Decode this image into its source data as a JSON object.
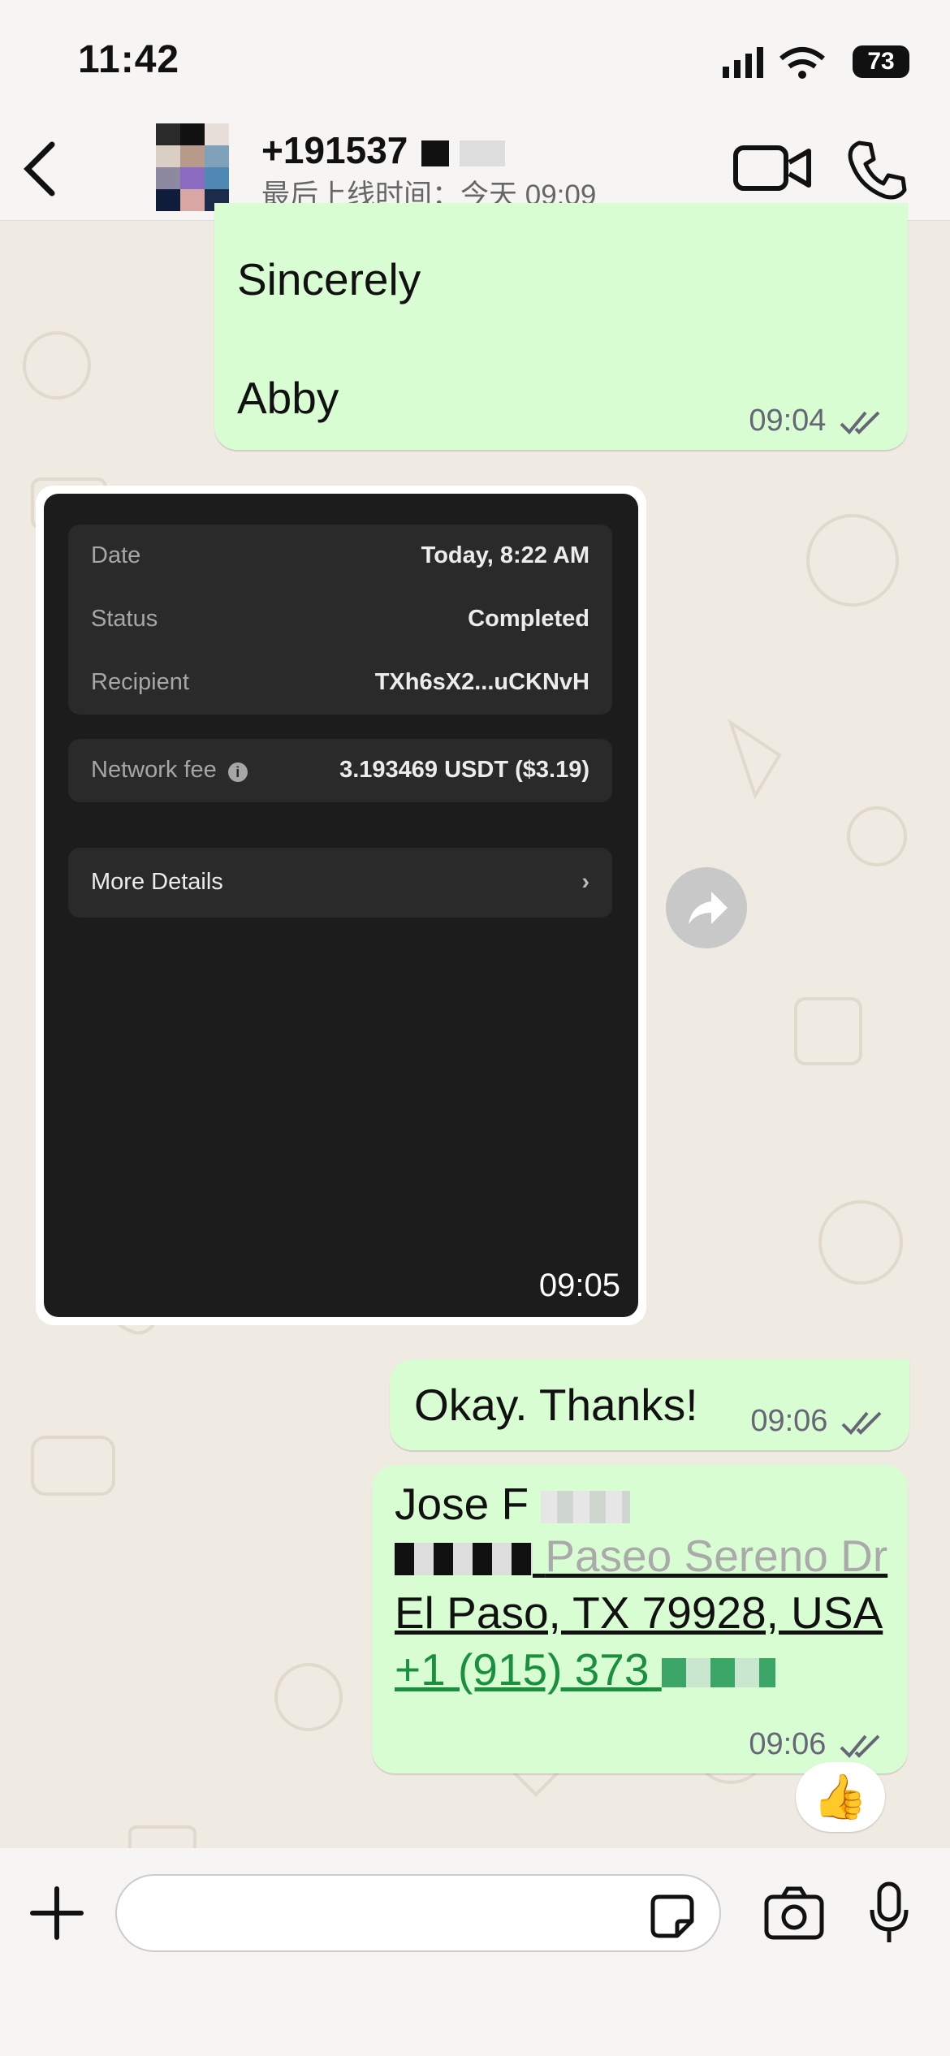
{
  "status_bar": {
    "time": "11:42",
    "battery": "73"
  },
  "header": {
    "contact": "+191537",
    "last_seen": "最后上线时间：今天 09:09"
  },
  "messages": {
    "m1": {
      "line1": "Sincerely",
      "line2": "Abby",
      "time": "09:04"
    },
    "m2": {
      "time": "09:05",
      "details": {
        "date_label": "Date",
        "date_value": "Today, 8:22 AM",
        "status_label": "Status",
        "status_value": "Completed",
        "recipient_label": "Recipient",
        "recipient_value": "TXh6sX2...uCKNvH",
        "fee_label": "Network fee",
        "fee_value": "3.193469 USDT ($3.19)",
        "more_label": "More Details"
      }
    },
    "m3": {
      "text": "Okay. Thanks!",
      "time": "09:06"
    },
    "m4": {
      "line1": "Jose F",
      "line2": "Paseo Sereno Dr",
      "line3": "El Paso, TX 79928, USA",
      "line4": "+1 (915) 373",
      "time": "09:06"
    },
    "reaction": "👍"
  },
  "colors": {
    "bubble_out": "#d9fdd3",
    "chat_bg": "#efeae2",
    "link_green": "#1a8f3e"
  }
}
